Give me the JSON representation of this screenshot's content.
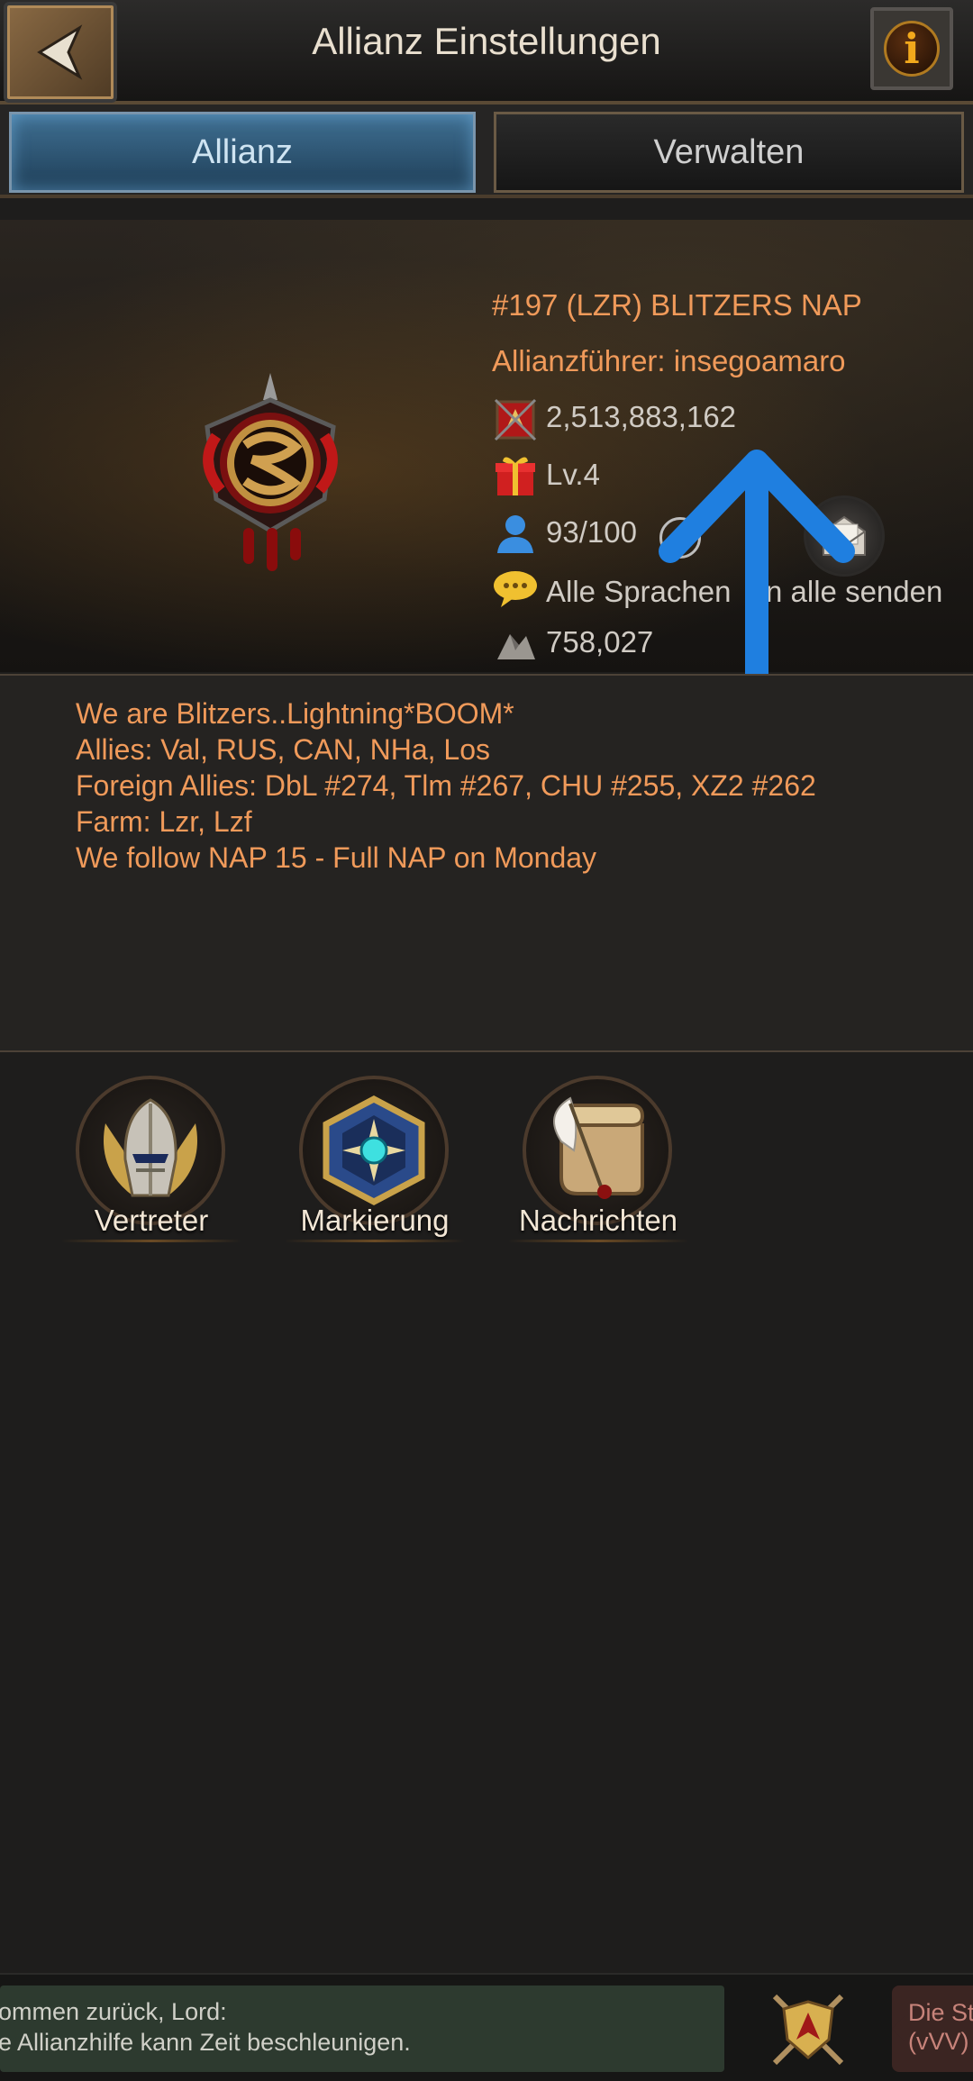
{
  "header": {
    "title": "Allianz Einstellungen",
    "back_icon": "back-arrow-icon",
    "info_glyph": "i"
  },
  "tabs": [
    {
      "label": "Allianz",
      "active": true
    },
    {
      "label": "Verwalten",
      "active": false
    }
  ],
  "alliance": {
    "name": "#197 (LZR) BLITZERS NAP",
    "leader": "Allianzführer: insegoamaro",
    "power": "2,513,883,162",
    "gift_level": "Lv.4",
    "members": "93/100",
    "language": "Alle Sprachen",
    "territory": "758,027",
    "send_all_label": "An alle senden"
  },
  "description": [
    "We are Blitzers..Lightning*BOOM*",
    "Allies: Val, RUS, CAN, NHa, Los",
    "Foreign Allies: DbL #274, Tlm #267, CHU #255, XZ2 #262",
    "Farm: Lzr, Lzf",
    "We follow NAP 15 - Full NAP on Monday"
  ],
  "actions": [
    {
      "label": "Vertreter",
      "icon": "knight-helmet-icon"
    },
    {
      "label": "Markierung",
      "icon": "gem-badge-icon"
    },
    {
      "label": "Nachrichten",
      "icon": "scroll-quill-icon"
    }
  ],
  "bottom": {
    "chat_line1": "ommen zurück, Lord:",
    "chat_line2": "e Allianzhilfe kann Zeit beschleunigen.",
    "event_line1": "Die St",
    "event_line2": "(vVV)"
  },
  "colors": {
    "accent_orange": "#f09a5a",
    "tab_active": "#3f6f92",
    "annotation_blue": "#1f7fe0"
  }
}
